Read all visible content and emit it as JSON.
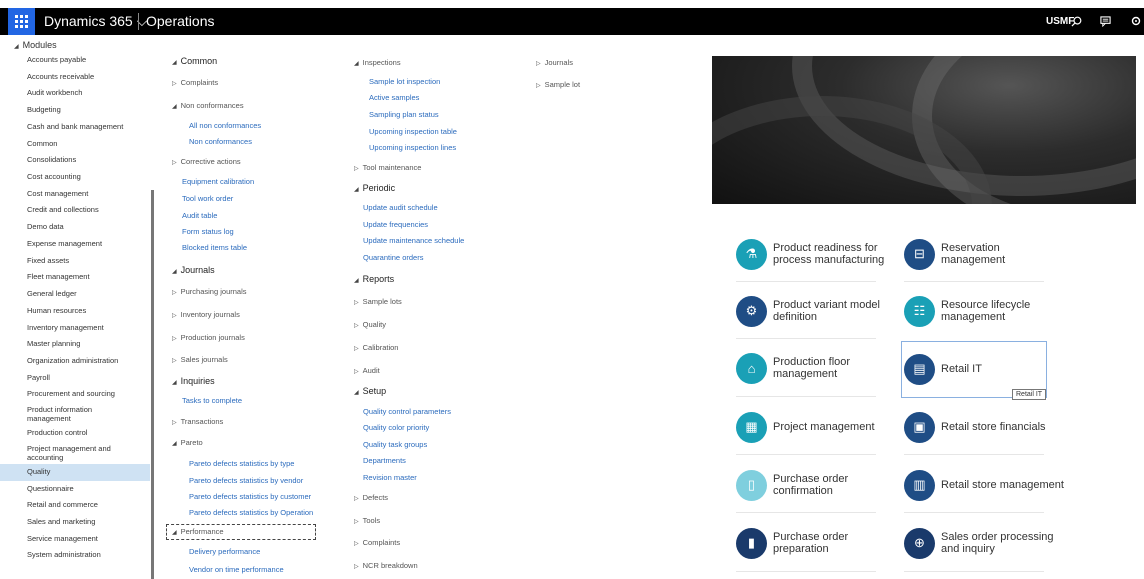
{
  "topbar": {
    "app_title": "Dynamics 365",
    "workspace": "Operations",
    "company": "USMF"
  },
  "icons": {
    "waffle": "waffle-icon",
    "chevron": "chevron-down-icon",
    "search": "search-icon",
    "messages": "message-icon",
    "settings": "gear-icon"
  },
  "sidebar": {
    "header": "Modules",
    "selected": "Quality",
    "items": [
      "Accounts payable",
      "Accounts receivable",
      "Audit workbench",
      "Budgeting",
      "Cash and bank management",
      "Common",
      "Consolidations",
      "Cost accounting",
      "Cost management",
      "Credit and collections",
      "Demo data",
      "Expense management",
      "Fixed assets",
      "Fleet management",
      "General ledger",
      "Human resources",
      "Inventory management",
      "Master planning",
      "Organization administration",
      "Payroll",
      "Procurement and sourcing",
      "Product information management",
      "Production control",
      "Project management and accounting",
      "Quality",
      "Questionnaire",
      "Retail and commerce",
      "Sales and marketing",
      "Service management",
      "System administration"
    ]
  },
  "menu1": {
    "common": "Common",
    "complaints": "Complaints",
    "non_conformances": "Non conformances",
    "all_non_conformances": "All non conformances",
    "non_conformances_link": "Non conformances",
    "corrective_actions": "Corrective actions",
    "equipment_calibration": "Equipment calibration",
    "tool_work_order": "Tool work order",
    "audit_table": "Audit table",
    "form_status_log": "Form status log",
    "blocked_items_table": "Blocked items table",
    "journals": "Journals",
    "purchasing_journals": "Purchasing journals",
    "inventory_journals": "Inventory journals",
    "production_journals": "Production journals",
    "sales_journals": "Sales journals",
    "inquiries": "Inquiries",
    "tasks_to_complete": "Tasks to complete",
    "transactions": "Transactions",
    "pareto": "Pareto",
    "pareto_type": "Pareto defects statistics by type",
    "pareto_vendor": "Pareto defects statistics by vendor",
    "pareto_customer": "Pareto defects statistics by customer",
    "pareto_operation": "Pareto defects statistics by Operation",
    "performance": "Performance",
    "delivery_performance": "Delivery performance",
    "vendor_on_time": "Vendor on time performance"
  },
  "menu2": {
    "inspections": "Inspections",
    "sample_lot_inspection": "Sample lot inspection",
    "active_samples": "Active samples",
    "sampling_plan_status": "Sampling plan status",
    "upcoming_inspection_table": "Upcoming inspection table",
    "upcoming_inspection_lines": "Upcoming inspection lines",
    "tool_maintenance": "Tool maintenance",
    "periodic": "Periodic",
    "update_audit_schedule": "Update audit schedule",
    "update_frequencies": "Update frequencies",
    "update_maintenance_schedule": "Update maintenance schedule",
    "quarantine_orders": "Quarantine orders",
    "reports": "Reports",
    "sample_lots": "Sample lots",
    "quality": "Quality",
    "calibration": "Calibration",
    "audit": "Audit",
    "setup": "Setup",
    "quality_control_parameters": "Quality control parameters",
    "quality_color_priority": "Quality color priority",
    "quality_task_groups": "Quality task groups",
    "departments": "Departments",
    "revision_master": "Revision master",
    "defects": "Defects",
    "tools": "Tools",
    "complaints": "Complaints",
    "ncr_breakdown": "NCR breakdown"
  },
  "menu3": {
    "journals": "Journals",
    "sample_lot": "Sample lot"
  },
  "tiles": {
    "product_readiness": "Product readiness for process manufacturing",
    "reservation": "Reservation management",
    "product_variant": "Product variant model definition",
    "resource_lifecycle": "Resource lifecycle management",
    "production_floor": "Production floor management",
    "retail_it": "Retail IT",
    "project_management": "Project management",
    "retail_store_financials": "Retail store financials",
    "purchase_order_confirmation": "Purchase order confirmation",
    "retail_store_management": "Retail store management",
    "purchase_order_preparation": "Purchase order preparation",
    "sales_order_processing": "Sales order processing and inquiry"
  },
  "tooltip": "Retail IT"
}
